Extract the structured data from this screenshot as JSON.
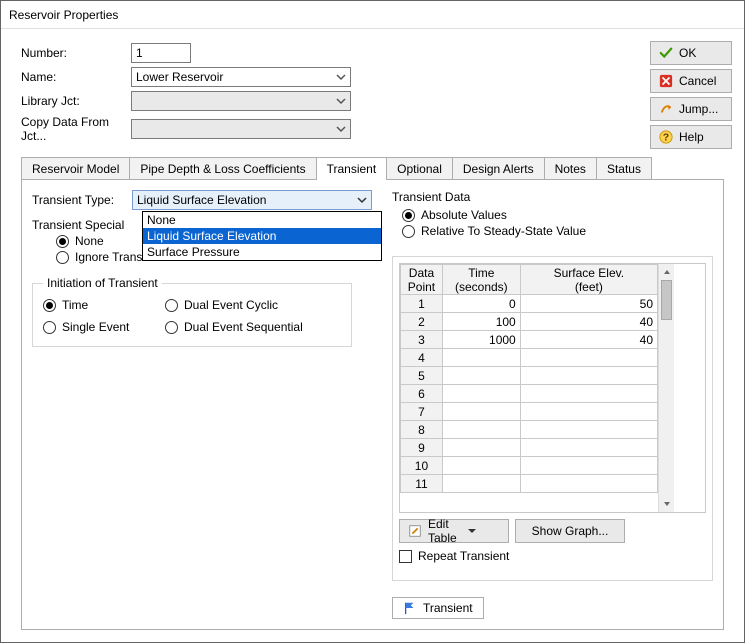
{
  "title": "Reservoir Properties",
  "buttons": {
    "ok": "OK",
    "cancel": "Cancel",
    "jump": "Jump...",
    "help": "Help"
  },
  "form": {
    "number_label": "Number:",
    "number_value": "1",
    "name_label": "Name:",
    "name_value": "Lower Reservoir",
    "library_label": "Library Jct:",
    "copy_label": "Copy Data From Jct..."
  },
  "tabs": {
    "reservoir_model": "Reservoir Model",
    "pipe_depth": "Pipe Depth & Loss Coefficients",
    "transient": "Transient",
    "optional": "Optional",
    "design_alerts": "Design Alerts",
    "notes": "Notes",
    "status": "Status"
  },
  "tt": {
    "label": "Transient Type:",
    "value": "Liquid Surface Elevation",
    "options": {
      "none": "None",
      "lse": "Liquid Surface Elevation",
      "sp": "Surface Pressure"
    }
  },
  "ts": {
    "label": "Transient Special",
    "none": "None",
    "ignore": "Ignore Transient Data"
  },
  "init": {
    "legend": "Initiation of Transient",
    "time": "Time",
    "single": "Single Event",
    "cyclic": "Dual Event Cyclic",
    "seq": "Dual Event Sequential"
  },
  "td": {
    "header": "Transient Data",
    "abs": "Absolute Values",
    "rel": "Relative To Steady-State Value",
    "col_dp": "Data\nPoint",
    "col_time": "Time\n(seconds)",
    "col_elev": "Surface Elev.\n(feet)",
    "rows": [
      {
        "i": "1",
        "t": "0",
        "e": "50"
      },
      {
        "i": "2",
        "t": "100",
        "e": "40"
      },
      {
        "i": "3",
        "t": "1000",
        "e": "40"
      },
      {
        "i": "4",
        "t": "",
        "e": ""
      },
      {
        "i": "5",
        "t": "",
        "e": ""
      },
      {
        "i": "6",
        "t": "",
        "e": ""
      },
      {
        "i": "7",
        "t": "",
        "e": ""
      },
      {
        "i": "8",
        "t": "",
        "e": ""
      },
      {
        "i": "9",
        "t": "",
        "e": ""
      },
      {
        "i": "10",
        "t": "",
        "e": ""
      },
      {
        "i": "11",
        "t": "",
        "e": ""
      }
    ],
    "edit_table": "Edit Table",
    "show_graph": "Show Graph...",
    "repeat": "Repeat Transient",
    "mini_tab": "Transient"
  }
}
